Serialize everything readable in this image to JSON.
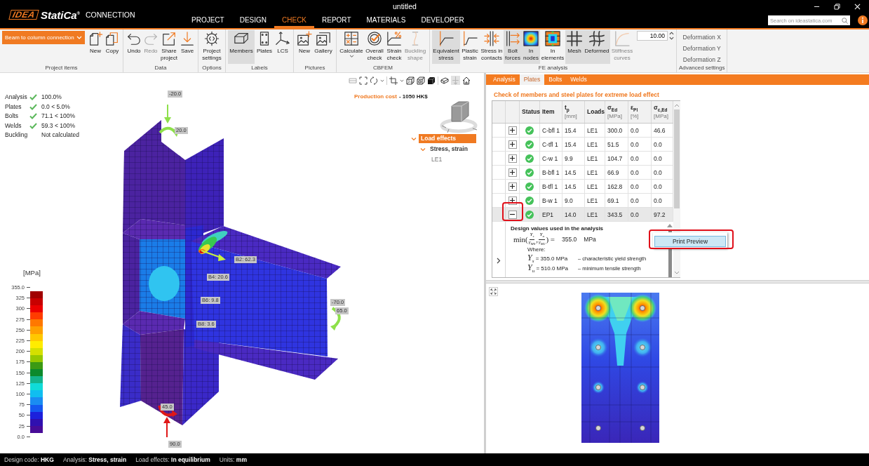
{
  "window": {
    "title": "untitled"
  },
  "logo": {
    "mark": "IDEA",
    "brand": "StatiCa$^{®}$",
    "product": "CONNECTION"
  },
  "menu_tabs": [
    {
      "label": "PROJECT",
      "selected": false
    },
    {
      "label": "DESIGN",
      "selected": false
    },
    {
      "label": "CHECK",
      "selected": true
    },
    {
      "label": "REPORT",
      "selected": false
    },
    {
      "label": "MATERIALS",
      "selected": false
    },
    {
      "label": "DEVELOPER",
      "selected": false
    }
  ],
  "search": {
    "placeholder": "Search on ideastatica.com"
  },
  "ribbon": {
    "groups": [
      {
        "label": "Project items",
        "items": [
          {
            "kind": "dropdown",
            "label": "Beam to column connection"
          },
          {
            "kind": "button",
            "label": "New",
            "selected": false,
            "disabled": false
          },
          {
            "kind": "button",
            "label": "Copy",
            "selected": false,
            "disabled": false
          }
        ]
      },
      {
        "label": "Data",
        "items": [
          {
            "kind": "button",
            "label": "Undo",
            "selected": false,
            "disabled": false
          },
          {
            "kind": "button",
            "label": "Redo",
            "selected": false,
            "disabled": true
          },
          {
            "kind": "button",
            "label": "Share project",
            "selected": false,
            "disabled": false
          },
          {
            "kind": "button",
            "label": "Save",
            "selected": false,
            "disabled": false
          }
        ]
      },
      {
        "label": "Options",
        "items": [
          {
            "kind": "button",
            "label": "Project settings",
            "selected": false,
            "disabled": false
          }
        ]
      },
      {
        "label": "Labels",
        "items": [
          {
            "kind": "button",
            "label": "Members",
            "selected": true,
            "disabled": false
          },
          {
            "kind": "button",
            "label": "Plates",
            "selected": false,
            "disabled": false
          },
          {
            "kind": "button",
            "label": "LCS",
            "selected": false,
            "disabled": false
          }
        ]
      },
      {
        "label": "Pictures",
        "items": [
          {
            "kind": "button",
            "label": "New",
            "selected": false,
            "disabled": false
          },
          {
            "kind": "button",
            "label": "Gallery",
            "selected": false,
            "disabled": false
          }
        ]
      },
      {
        "label": "CBFEM",
        "items": [
          {
            "kind": "button",
            "label": "Calculate",
            "selected": false,
            "disabled": false,
            "menu": true
          },
          {
            "kind": "button",
            "label": "Overall check",
            "selected": false,
            "disabled": false
          },
          {
            "kind": "button",
            "label": "Strain check",
            "selected": false,
            "disabled": false
          },
          {
            "kind": "button",
            "label": "Buckling shape",
            "selected": false,
            "disabled": true
          }
        ]
      },
      {
        "label": "FE analysis",
        "items": [
          {
            "kind": "button",
            "label": "Equivalent stress",
            "selected": true,
            "disabled": false
          },
          {
            "kind": "button",
            "label": "Plastic strain",
            "selected": false,
            "disabled": false
          },
          {
            "kind": "button",
            "label": "Stress in contacts",
            "selected": false,
            "disabled": false
          },
          {
            "kind": "button",
            "label": "Bolt forces",
            "selected": true,
            "disabled": false
          },
          {
            "kind": "button",
            "label": "In nodes",
            "selected": true,
            "disabled": false
          },
          {
            "kind": "button",
            "label": "In elements",
            "selected": false,
            "disabled": false
          },
          {
            "kind": "button",
            "label": "Mesh",
            "selected": true,
            "disabled": false
          },
          {
            "kind": "button",
            "label": "Deformed",
            "selected": true,
            "disabled": false
          },
          {
            "kind": "button",
            "label": "Stiffness curves",
            "selected": false,
            "disabled": true
          },
          {
            "kind": "spinner",
            "value": "10.00"
          }
        ]
      },
      {
        "label": "Advanced settings",
        "items": [
          {
            "kind": "link",
            "label": "Deformation X"
          },
          {
            "kind": "link",
            "label": "Deformation Y"
          },
          {
            "kind": "link",
            "label": "Deformation Z"
          }
        ]
      }
    ]
  },
  "viewport": {
    "summary": [
      {
        "label": "Analysis",
        "passed": true,
        "value": "100.0%"
      },
      {
        "label": "Plates",
        "passed": true,
        "value": "0.0 < 5.0%"
      },
      {
        "label": "Bolts",
        "passed": true,
        "value": "71.1 < 100%"
      },
      {
        "label": "Welds",
        "passed": true,
        "value": "59.3 < 100%"
      },
      {
        "label": "Buckling",
        "passed": false,
        "value": "Not calculated"
      }
    ],
    "production_cost": {
      "label": "Production cost",
      "value": "- 1050 HK$"
    },
    "tree": [
      {
        "label": "Load effects",
        "selected": true,
        "expanded": true,
        "children": [
          {
            "label": "Stress, strain",
            "selected": false,
            "expanded": true,
            "children": [
              {
                "label": "LE1",
                "selected": false
              }
            ]
          }
        ]
      }
    ],
    "load_labels": [
      "-20.0",
      "20.0",
      "-70.0",
      "65.0",
      "45.0",
      "90.0"
    ],
    "bolt_labels": [
      "B2: 62.3",
      "B4: 20.6",
      "B6: 9.8",
      "B8: 3.6"
    ],
    "legend": {
      "unit": "[MPa]",
      "ticks": [
        "355.0",
        "325",
        "300",
        "275",
        "250",
        "225",
        "200",
        "175",
        "150",
        "125",
        "100",
        "75",
        "50",
        "25",
        "0.0"
      ],
      "bands": [
        {
          "color": "#a00000"
        },
        {
          "color": "#c80000"
        },
        {
          "color": "#ec0000"
        },
        {
          "color": "#ff3c00"
        },
        {
          "color": "#ff7800"
        },
        {
          "color": "#ffa000"
        },
        {
          "color": "#ffc800"
        },
        {
          "color": "#ffec00"
        },
        {
          "color": "#d4e000"
        },
        {
          "color": "#96c800"
        },
        {
          "color": "#3c9a14"
        },
        {
          "color": "#0c8a2c"
        },
        {
          "color": "#14b48c"
        },
        {
          "color": "#10dcd8"
        },
        {
          "color": "#10bef0"
        },
        {
          "color": "#1a8cf2"
        },
        {
          "color": "#1458f0"
        },
        {
          "color": "#1c20dc"
        },
        {
          "color": "#3010b0"
        },
        {
          "color": "#480c98"
        }
      ]
    }
  },
  "results_panel": {
    "tabs": [
      {
        "label": "Analysis",
        "selected": false
      },
      {
        "label": "Plates",
        "selected": true
      },
      {
        "label": "Bolts",
        "selected": false
      },
      {
        "label": "Welds",
        "selected": false
      }
    ],
    "title": "Check of members and steel plates for extreme load effect",
    "table": {
      "status_header": "Status",
      "columns": [
        {
          "label": "Item"
        },
        {
          "label": "t$_{p}$",
          "unit": "[mm]"
        },
        {
          "label": "Loads"
        },
        {
          "label": "σ$_{Ed}$",
          "unit": "[MPa]"
        },
        {
          "label": "ε$_{Pl}$",
          "unit": "[%]"
        },
        {
          "label": "σ$_{c,Ed}$",
          "unit": "[MPa]"
        }
      ],
      "rows": [
        {
          "expanded": false,
          "highlighted": false,
          "selected": false,
          "passed": true,
          "cells": [
            "C-bfl 1",
            "15.4",
            "LE1",
            "300.0",
            "0.0",
            "46.6"
          ]
        },
        {
          "expanded": false,
          "highlighted": false,
          "selected": false,
          "passed": true,
          "cells": [
            "C-tfl 1",
            "15.4",
            "LE1",
            "51.5",
            "0.0",
            "0.0"
          ]
        },
        {
          "expanded": false,
          "highlighted": false,
          "selected": false,
          "passed": true,
          "cells": [
            "C-w 1",
            "9.9",
            "LE1",
            "104.7",
            "0.0",
            "0.0"
          ]
        },
        {
          "expanded": false,
          "highlighted": false,
          "selected": false,
          "passed": true,
          "cells": [
            "B-bfl 1",
            "14.5",
            "LE1",
            "66.9",
            "0.0",
            "0.0"
          ]
        },
        {
          "expanded": false,
          "highlighted": false,
          "selected": false,
          "passed": true,
          "cells": [
            "B-tfl 1",
            "14.5",
            "LE1",
            "162.8",
            "0.0",
            "0.0"
          ]
        },
        {
          "expanded": false,
          "highlighted": false,
          "selected": false,
          "passed": true,
          "cells": [
            "B-w 1",
            "9.0",
            "LE1",
            "69.1",
            "0.0",
            "0.0"
          ]
        },
        {
          "expanded": true,
          "highlighted": true,
          "selected": true,
          "passed": true,
          "cells": [
            "EP1",
            "14.0",
            "LE1",
            "343.5",
            "0.0",
            "97.2"
          ],
          "detail": {
            "heading": "Design values used in the analysis",
            "formula": [
              {
                "kind": "text",
                "text": "min("
              },
              {
                "kind": "fraction",
                "numerator": "Y$_{s}$",
                "denominator": "γ$_{M0}$"
              },
              {
                "kind": "text",
                "text": ","
              },
              {
                "kind": "fraction",
                "numerator": "Y$_{u}$",
                "denominator": "γ$_{M2}$"
              },
              {
                "kind": "text",
                "text": ") ="
              }
            ],
            "result": "355.0",
            "unit": "MPa",
            "where": "Where:",
            "definitions": [
              {
                "symbol": "Y$_{s}$",
                "value": "= 355.0 MPa",
                "description": "– characteristic yield strength"
              },
              {
                "symbol": "Y$_{u}$",
                "value": "= 510.0 MPa",
                "description": "– minimum tensile strength"
              }
            ]
          }
        }
      ]
    },
    "popup": {
      "label": "Print Preview",
      "highlighted": true
    }
  },
  "status_bar": [
    "Design code: **HKG**",
    "Analysis: **Stress, strain**",
    "Load effects: **In equilibrium**",
    "Units: **mm**"
  ]
}
